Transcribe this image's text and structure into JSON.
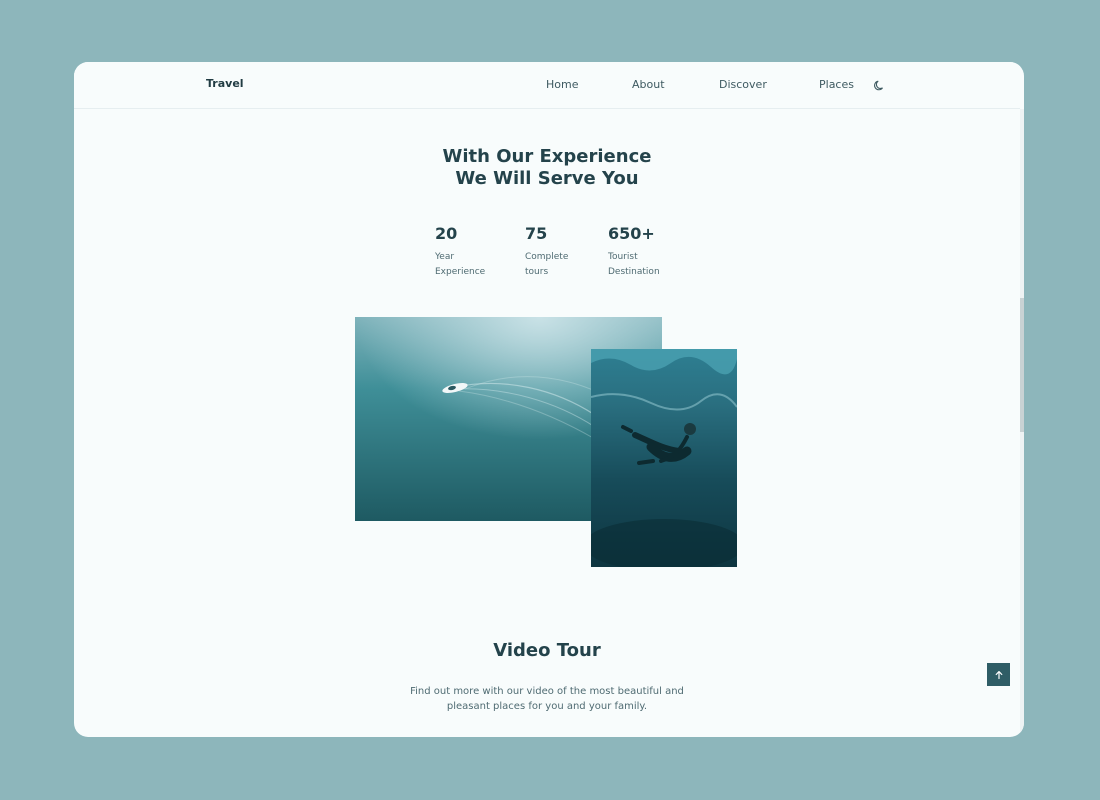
{
  "header": {
    "logo": "Travel",
    "nav": [
      "Home",
      "About",
      "Discover",
      "Places"
    ],
    "theme_icon": "moon-icon"
  },
  "experience": {
    "title_line1": "With Our Experience",
    "title_line2": "We Will Serve You",
    "stats": [
      {
        "number": "20",
        "label_line1": "Year",
        "label_line2": "Experience"
      },
      {
        "number": "75",
        "label_line1": "Complete",
        "label_line2": "tours"
      },
      {
        "number": "650+",
        "label_line1": "Tourist",
        "label_line2": "Destination"
      }
    ],
    "images": [
      "boat-aerial-image",
      "diver-underwater-image"
    ]
  },
  "video": {
    "title": "Video Tour",
    "description_line1": "Find out more with our video of the most beautiful and",
    "description_line2": "pleasant places for you and your family."
  },
  "scrollup_icon": "arrow-up-icon",
  "colors": {
    "page_bg": "#8db6bb",
    "window_bg": "#f8fcfc",
    "heading": "#24434b",
    "text": "#4f6b72",
    "accent": "#2f5d66"
  }
}
